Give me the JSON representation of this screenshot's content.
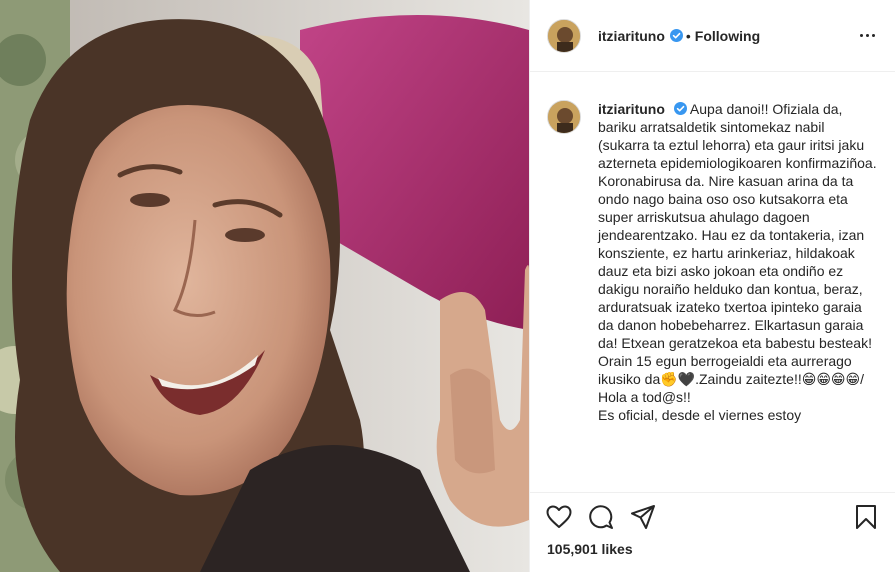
{
  "post": {
    "username": "itziarituno",
    "verified": true,
    "separator": "•",
    "follow_status": "Following",
    "more_icon": "more-options-icon",
    "caption": "Aupa danoi!! Ofiziala da, bariku arratsaldetik sintomekaz nabil (sukarra ta eztul lehorra) eta gaur iritsi jaku azterneta epidemiologikoaren konfirmaziñoa. Koronabirusa da. Nire kasuan arina da ta ondo nago baina oso oso kutsakorra eta super arriskutsua ahulago dagoen jendearentzako. Hau ez da tontakeria, izan konsziente, ez hartu arinkeriaz, hildakoak dauz eta bizi asko jokoan eta ondiño ez dakigu noraiño helduko dan kontua, beraz, arduratsuak izateko txertoa ipinteko garaia da danon hobebeharrez. Elkartasun garaia da! Etxean geratzekoa eta babestu besteak!\nOrain 15 egun berrogeialdi eta aurrerago ikusiko da✊🖤.Zaindu zaitezte!!😁😁😁😁/ Hola a tod@s!!\nEs oficial, desde el viernes estoy",
    "likes_count": "105,901 likes",
    "colors": {
      "text": "#262626",
      "border": "#efefef",
      "verified": "#3897f0",
      "photo_pillow": "#b2336f"
    }
  },
  "actions": {
    "like_icon": "heart-icon",
    "comment_icon": "comment-icon",
    "share_icon": "share-icon",
    "save_icon": "bookmark-icon"
  }
}
